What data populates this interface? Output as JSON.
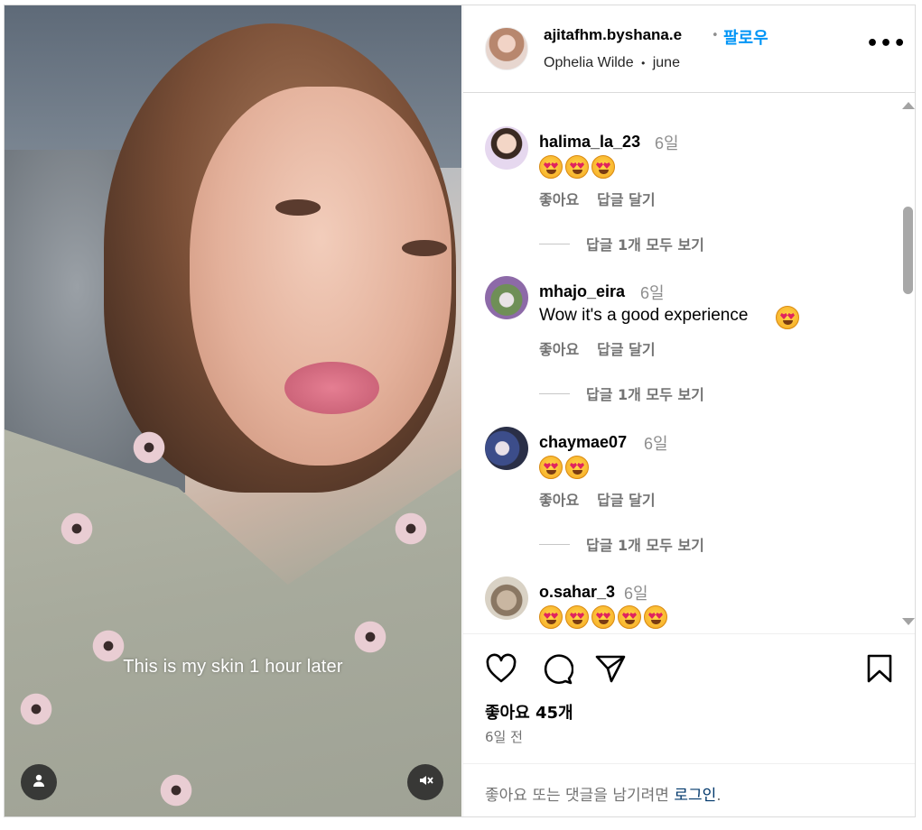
{
  "post": {
    "username": "ajitafhm.byshana.e",
    "dot": "•",
    "follow_label": "팔로우",
    "audio_artist": "Ophelia Wilde",
    "audio_track": "june",
    "more_icon": "more-horizontal-icon",
    "video_caption": "This is my skin 1 hour later"
  },
  "comments": [
    {
      "user": "halima_la_23",
      "time": "6일",
      "text": "",
      "emoji_count": 3,
      "like_label": "좋아요",
      "reply_label": "답글 달기",
      "view_replies": "답글 1개 모두 보기"
    },
    {
      "user": "mhajo_eira",
      "time": "6일",
      "text": "Wow it's a good experience",
      "emoji_count": 1,
      "like_label": "좋아요",
      "reply_label": "답글 달기",
      "view_replies": "답글 1개 모두 보기"
    },
    {
      "user": "chaymae07",
      "time": "6일",
      "text": "",
      "emoji_count": 2,
      "like_label": "좋아요",
      "reply_label": "답글 달기",
      "view_replies": "답글 1개 모두 보기"
    },
    {
      "user": "o.sahar_3",
      "time": "6일",
      "text": "",
      "emoji_count": 5
    }
  ],
  "footer": {
    "likes_label": "좋아요 45개",
    "date_label": "6일 전",
    "login_prompt": "좋아요 또는 댓글을 남기려면",
    "login_link": "로그인",
    "login_suffix": "."
  },
  "colors": {
    "accent": "#0095f6",
    "muted": "#737373",
    "border": "#dbdbdb",
    "link": "#00376b"
  }
}
